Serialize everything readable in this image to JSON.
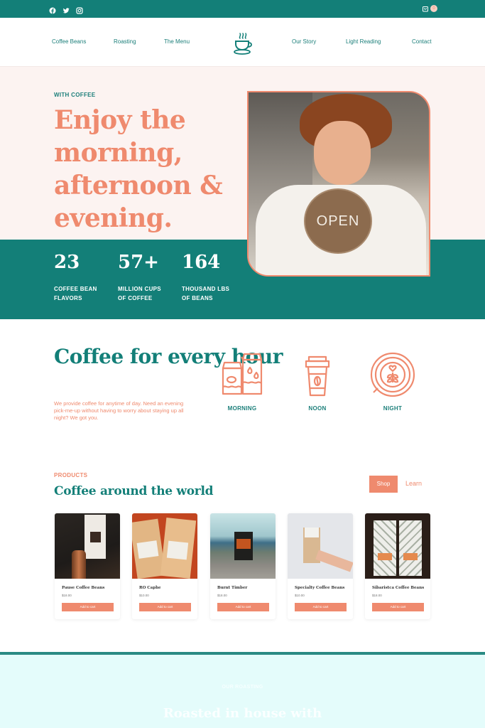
{
  "topbar": {
    "social_icons": [
      "facebook-icon",
      "twitter-icon",
      "instagram-icon"
    ],
    "cart_count": "0"
  },
  "nav": {
    "left": [
      "Coffee Beans",
      "Roasting",
      "The Menu"
    ],
    "right": [
      "Our Story",
      "Light Reading",
      "Contact"
    ],
    "logo": "coffee-cup-logo"
  },
  "hero": {
    "eyebrow": "WITH COFFEE",
    "title": "Enjoy the morning, afternoon & evening.",
    "image_sign_text": "OPEN",
    "stats": [
      {
        "value": "23",
        "label": "COFFEE BEAN\nFLAVORS"
      },
      {
        "value": "57+",
        "label": "MILLION CUPS\nOF COFFEE"
      },
      {
        "value": "164",
        "label": "THOUSAND LBS\nOF BEANS"
      }
    ]
  },
  "hours": {
    "title": "Coffee for every hour",
    "description": "We provide coffee for anytime of day. Need an evening pick-me-up without having to worry about staying up all night? We got you.",
    "items": [
      {
        "label": "MORNING",
        "icon": "milk-cartons-icon"
      },
      {
        "label": "NOON",
        "icon": "takeaway-cup-icon"
      },
      {
        "label": "NIGHT",
        "icon": "latte-art-cup-icon"
      }
    ]
  },
  "products": {
    "eyebrow": "PRODUCTS",
    "title": "Coffee around the world",
    "shop_label": "Shop",
    "learn_label": "Learn",
    "items": [
      {
        "name": "Pause Coffee Beans",
        "price": "$18.00",
        "button": "Add to cart"
      },
      {
        "name": "RO Caphe",
        "price": "$10.00",
        "button": "Add to cart"
      },
      {
        "name": "Burnt Timber",
        "price": "$18.00",
        "button": "Add to cart"
      },
      {
        "name": "Specialty Coffee Beans",
        "price": "$10.00",
        "button": "Add to cart"
      },
      {
        "name": "Sibaristca Coffee Beans",
        "price": "$18.00",
        "button": "Add to cart"
      }
    ]
  },
  "roasted": {
    "eyebrow": "OUR ROASTING",
    "title": "Roasted in house with"
  },
  "colors": {
    "teal": "#137f78",
    "coral": "#ef8a6e",
    "hero_bg": "#fcf3f1",
    "bottom_bg": "#e4fcfb"
  }
}
